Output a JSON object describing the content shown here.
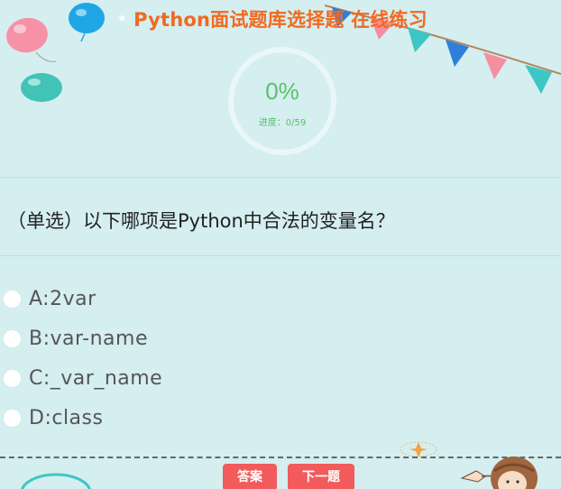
{
  "header": {
    "title": "Python面试题库选择题 在线练习"
  },
  "progress": {
    "percent_text": "0%",
    "label": "进度：0/59",
    "fraction": 0
  },
  "question": {
    "text": "（单选）以下哪项是Python中合法的变量名？",
    "options": [
      {
        "label": "A:2var"
      },
      {
        "label": "B:var-name"
      },
      {
        "label": "C:_var_name"
      },
      {
        "label": "D:class"
      }
    ]
  },
  "buttons": {
    "answer_label": "答案",
    "next_label": "下一题"
  },
  "colors": {
    "background": "#d5eef0",
    "title": "#f06a20",
    "progress": "#58c26a",
    "button": "#f25b5b"
  }
}
